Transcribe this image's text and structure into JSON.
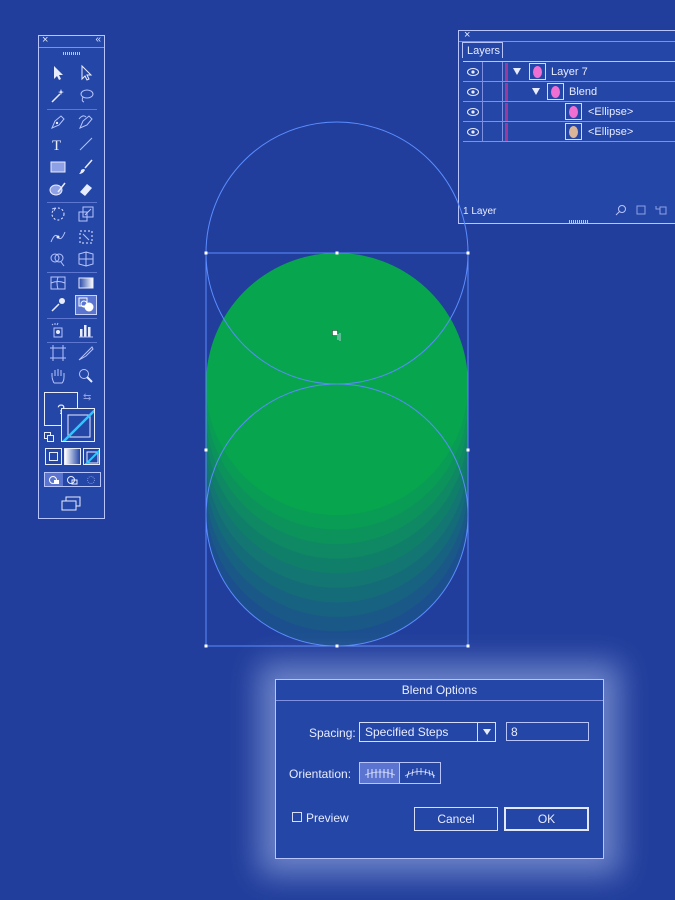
{
  "tools_panel": {
    "close_label": "×",
    "collapse_label": "«",
    "unknown_fill_label": "?"
  },
  "layers_panel": {
    "close_label": "×",
    "tab_label": "Layers",
    "rows": [
      {
        "name": "Layer 7",
        "thumb_color": "#f06fd2"
      },
      {
        "name": "Blend",
        "thumb_color": "#f06fd2"
      },
      {
        "name": "<Ellipse>",
        "thumb_color": "#f06fd2"
      },
      {
        "name": "<Ellipse>",
        "thumb_color": "#d9b69a"
      }
    ],
    "footer_label": "1 Layer"
  },
  "canvas": {
    "top_fill": "#07a64e",
    "bottom_fill": "#1c4f8e"
  },
  "blend_dialog": {
    "title": "Blend Options",
    "spacing_label": "Spacing:",
    "spacing_value": "Specified Steps",
    "steps_value": "8",
    "orientation_label": "Orientation:",
    "preview_label": "Preview",
    "cancel_label": "Cancel",
    "ok_label": "OK"
  }
}
